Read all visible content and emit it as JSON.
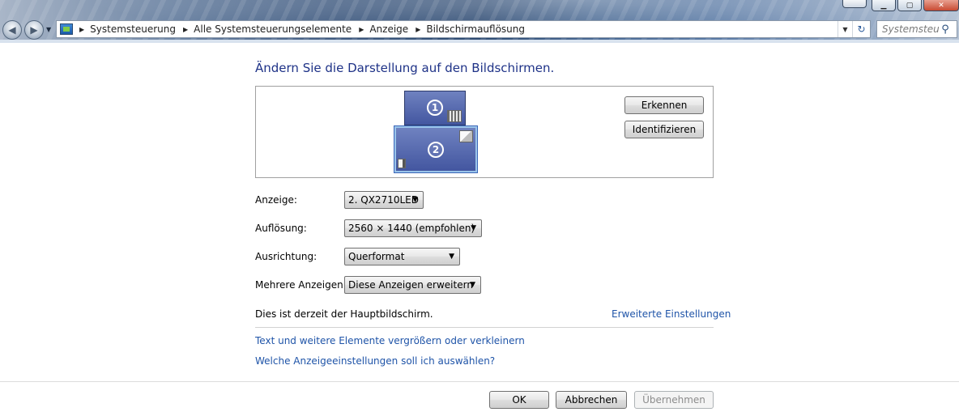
{
  "breadcrumb": [
    "Systemsteuerung",
    "Alle Systemsteuerungselemente",
    "Anzeige",
    "Bildschirmauflösung"
  ],
  "search": {
    "placeholder": "Systemsteu..."
  },
  "page_title": "Ändern Sie die Darstellung auf den Bildschirmen.",
  "monitors": [
    {
      "number": "1"
    },
    {
      "number": "2"
    }
  ],
  "buttons": {
    "detect": "Erkennen",
    "identify": "Identifizieren",
    "ok": "OK",
    "cancel": "Abbrechen",
    "apply": "Übernehmen"
  },
  "form": {
    "display": {
      "label": "Anzeige:",
      "value": "2. QX2710LED"
    },
    "resolution": {
      "label": "Auflösung:",
      "value": "2560 × 1440 (empfohlen)"
    },
    "orientation": {
      "label": "Ausrichtung:",
      "value": "Querformat"
    },
    "multiple": {
      "label": "Mehrere Anzeigen:",
      "value": "Diese Anzeigen erweitern"
    }
  },
  "info_text": "Dies ist derzeit der Hauptbildschirm.",
  "links": {
    "advanced": "Erweiterte Einstellungen",
    "text_size": "Text und weitere Elemente vergrößern oder verkleinern",
    "which_settings": "Welche Anzeigeeinstellungen soll ich auswählen?"
  },
  "colors": {
    "link": "#1f54a8",
    "title": "#1e3287",
    "monitor": "#4356a0"
  }
}
